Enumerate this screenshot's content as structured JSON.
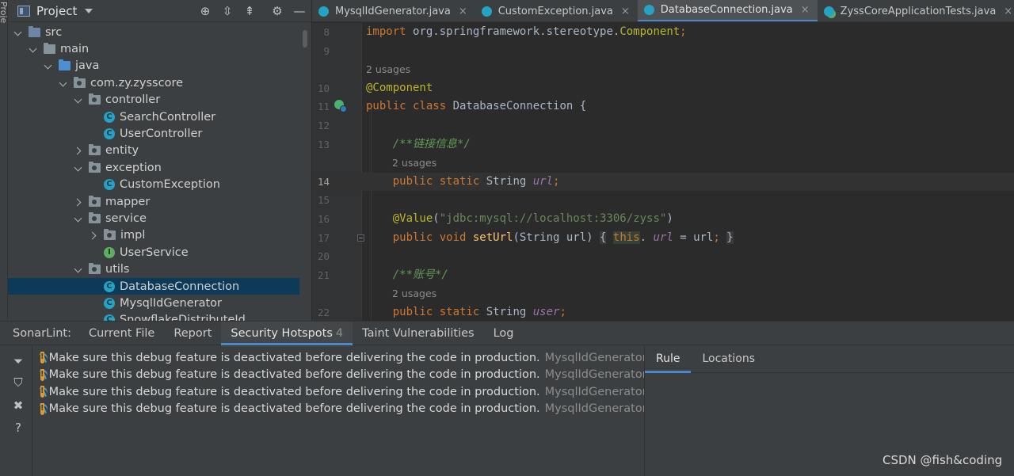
{
  "left_strip": {
    "label": "Proje"
  },
  "project": {
    "title": "Project",
    "tree": [
      {
        "label": "src",
        "depth": 1,
        "arrow": "open",
        "icon": "folder-src"
      },
      {
        "label": "main",
        "depth": 2,
        "arrow": "open",
        "icon": "folder"
      },
      {
        "label": "java",
        "depth": 3,
        "arrow": "open",
        "icon": "folder-java"
      },
      {
        "label": "com.zy.zysscore",
        "depth": 4,
        "arrow": "open",
        "icon": "package"
      },
      {
        "label": "controller",
        "depth": 5,
        "arrow": "open",
        "icon": "package"
      },
      {
        "label": "SearchController",
        "depth": 6,
        "arrow": "none",
        "icon": "class"
      },
      {
        "label": "UserController",
        "depth": 6,
        "arrow": "none",
        "icon": "class"
      },
      {
        "label": "entity",
        "depth": 5,
        "arrow": "closed",
        "icon": "package"
      },
      {
        "label": "exception",
        "depth": 5,
        "arrow": "open",
        "icon": "package"
      },
      {
        "label": "CustomException",
        "depth": 6,
        "arrow": "none",
        "icon": "class"
      },
      {
        "label": "mapper",
        "depth": 5,
        "arrow": "closed",
        "icon": "package"
      },
      {
        "label": "service",
        "depth": 5,
        "arrow": "open",
        "icon": "package"
      },
      {
        "label": "impl",
        "depth": 6,
        "arrow": "closed",
        "icon": "package"
      },
      {
        "label": "UserService",
        "depth": 6,
        "arrow": "none",
        "icon": "interface"
      },
      {
        "label": "utils",
        "depth": 5,
        "arrow": "open",
        "icon": "package"
      },
      {
        "label": "DatabaseConnection",
        "depth": 6,
        "arrow": "none",
        "icon": "class",
        "selected": true
      },
      {
        "label": "MysqlIdGenerator",
        "depth": 6,
        "arrow": "none",
        "icon": "class"
      },
      {
        "label": "SnowflakeDistributeId",
        "depth": 6,
        "arrow": "none",
        "icon": "class"
      }
    ]
  },
  "tabs": [
    {
      "label": "MysqlIdGenerator.java",
      "active": false,
      "icon": "class"
    },
    {
      "label": "CustomException.java",
      "active": false,
      "icon": "class"
    },
    {
      "label": "DatabaseConnection.java",
      "active": true,
      "icon": "class"
    },
    {
      "label": "ZyssCoreApplicationTests.java",
      "active": false,
      "icon": "test"
    },
    {
      "label": "ZyssCoreApplicat",
      "active": false,
      "icon": "test"
    }
  ],
  "editor": {
    "lines": [
      {
        "num": "8",
        "tokens": [
          [
            "kw",
            "import "
          ],
          [
            "",
            "org.springframework.stereotype."
          ],
          [
            "ann",
            "Component"
          ],
          [
            "kw",
            ";"
          ]
        ]
      },
      {
        "num": "9",
        "tokens": []
      },
      {
        "usage": "2 usages"
      },
      {
        "num": "10",
        "tokens": [
          [
            "ann",
            "@Component"
          ]
        ]
      },
      {
        "num": "11",
        "bean": true,
        "tokens": [
          [
            "kw",
            "public class "
          ],
          [
            "",
            "DatabaseConnection {"
          ]
        ]
      },
      {
        "num": "12",
        "tokens": []
      },
      {
        "num": "13",
        "tokens": [
          [
            "",
            "    "
          ],
          [
            "cmt",
            "/**链接信息*/"
          ]
        ]
      },
      {
        "usage": "    2 usages"
      },
      {
        "num": "14",
        "current": true,
        "tokens": [
          [
            "",
            "    "
          ],
          [
            "kw",
            "public static "
          ],
          [
            "",
            "String "
          ],
          [
            "fld",
            "url"
          ],
          [
            "kw",
            ";"
          ]
        ]
      },
      {
        "num": "15",
        "tokens": []
      },
      {
        "num": "16",
        "tokens": [
          [
            "",
            "    "
          ],
          [
            "ann",
            "@Value"
          ],
          [
            "",
            "("
          ],
          [
            "str",
            "\"jdbc:mysql://localhost:3306/zyss\""
          ],
          [
            "",
            ")"
          ]
        ]
      },
      {
        "num": "17",
        "fold": true,
        "tokens": [
          [
            "",
            "    "
          ],
          [
            "kw",
            "public void "
          ],
          [
            "fn",
            "setUrl"
          ],
          [
            "",
            "(String url) "
          ],
          [
            "hl",
            "{"
          ],
          [
            "",
            " "
          ],
          [
            "hl-this kw",
            "this"
          ],
          [
            "",
            ". "
          ],
          [
            "fld",
            "url"
          ],
          [
            "",
            " = url"
          ],
          [
            "kw",
            ";"
          ],
          [
            "",
            " "
          ],
          [
            "hl",
            "}"
          ]
        ]
      },
      {
        "num": "20",
        "tokens": []
      },
      {
        "num": "21",
        "tokens": [
          [
            "",
            "    "
          ],
          [
            "cmt",
            "/**账号*/"
          ]
        ]
      },
      {
        "usage": "    2 usages"
      },
      {
        "num": "22",
        "tokens": [
          [
            "",
            "    "
          ],
          [
            "kw",
            "public static "
          ],
          [
            "",
            "String "
          ],
          [
            "fld",
            "user"
          ],
          [
            "kw",
            ";"
          ]
        ]
      }
    ]
  },
  "tool_window": {
    "tabs": [
      {
        "label": "SonarLint:",
        "kind": "label"
      },
      {
        "label": "Current File"
      },
      {
        "label": "Report"
      },
      {
        "label": "Security Hotspots",
        "count": "4",
        "active": true
      },
      {
        "label": "Taint Vulnerabilities"
      },
      {
        "label": "Log"
      }
    ],
    "issues": [
      {
        "message": "Make sure this debug feature is deactivated before delivering the code in production.",
        "file": "MysqlIdGenerator.java"
      },
      {
        "message": "Make sure this debug feature is deactivated before delivering the code in production.",
        "file": "MysqlIdGenerator.java"
      },
      {
        "message": "Make sure this debug feature is deactivated before delivering the code in production.",
        "file": "MysqlIdGenerator.java"
      },
      {
        "message": "Make sure this debug feature is deactivated before delivering the code in production.",
        "file": "MysqlIdGenerator.java"
      }
    ],
    "rule_tabs": [
      {
        "label": "Rule",
        "active": true
      },
      {
        "label": "Locations",
        "active": false
      }
    ]
  },
  "watermark": "CSDN @fish&coding",
  "colors": {
    "accent": "#4a88c7",
    "selection": "#0d3a58",
    "keyword": "#cc7832",
    "annotation": "#bbb529"
  }
}
